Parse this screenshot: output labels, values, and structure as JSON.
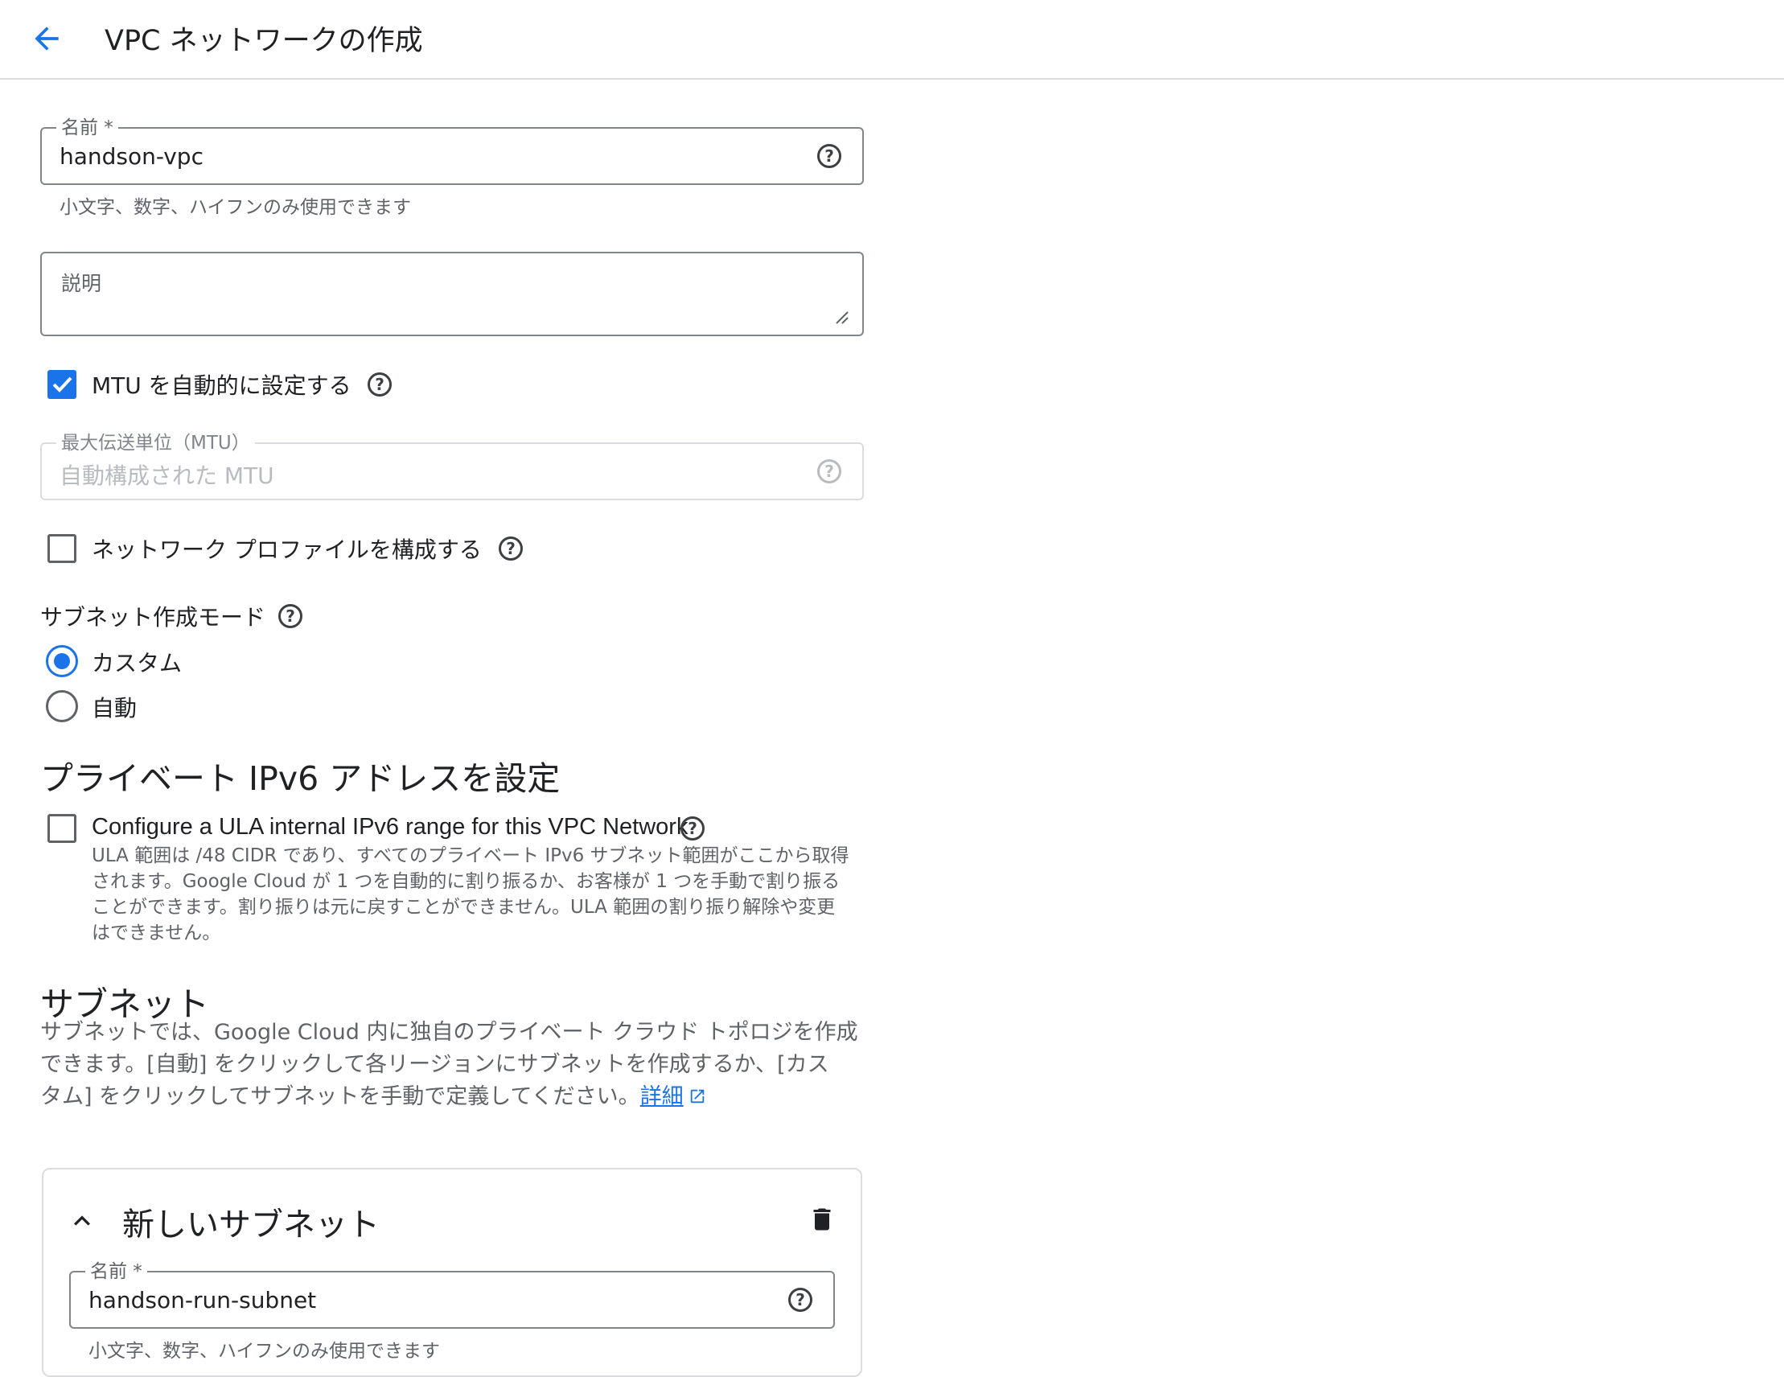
{
  "header": {
    "title": "VPC ネットワークの作成"
  },
  "name_field": {
    "label": "名前 *",
    "value": "handson-vpc",
    "hint": "小文字、数字、ハイフンのみ使用できます"
  },
  "description_field": {
    "label": "説明"
  },
  "mtu_auto": {
    "label": "MTU を自動的に設定する",
    "checked": true
  },
  "mtu_field": {
    "label": "最大伝送単位（MTU）",
    "placeholder": "自動構成された MTU"
  },
  "network_profile": {
    "label": "ネットワーク プロファイルを構成する",
    "checked": false
  },
  "subnet_mode": {
    "label": "サブネット作成モード",
    "options": [
      "カスタム",
      "自動"
    ],
    "selected": "カスタム"
  },
  "ipv6": {
    "heading": "プライベート IPv6 アドレスを設定",
    "checkbox_label": "Configure a ULA internal IPv6 range for this VPC Network",
    "description_lines": [
      "ULA 範囲は /48 CIDR であり、すべてのプライベート IPv6 サブネット範囲がここから取得",
      "されます。Google Cloud が 1 つを自動的に割り振るか、お客様が 1 つを手動で割り振る",
      "ことができます。割り振りは元に戻すことができません。ULA 範囲の割り振り解除や変更",
      "はできません。"
    ]
  },
  "subnets": {
    "heading": "サブネット",
    "description_lines": [
      "サブネットでは、Google Cloud 内に独自のプライベート クラウド トポロジを作成",
      "できます。[自動] をクリックして各リージョンにサブネットを作成するか、[カス",
      "タム] をクリックしてサブネットを手動で定義してください。"
    ],
    "learn_more": "詳細"
  },
  "new_subnet": {
    "title": "新しいサブネット",
    "name_label": "名前 *",
    "name_value": "handson-run-subnet",
    "hint": "小文字、数字、ハイフンのみ使用できます"
  },
  "colors": {
    "accent": "#1a73e8",
    "border": "#80868b",
    "muted_text": "#5f6368"
  }
}
